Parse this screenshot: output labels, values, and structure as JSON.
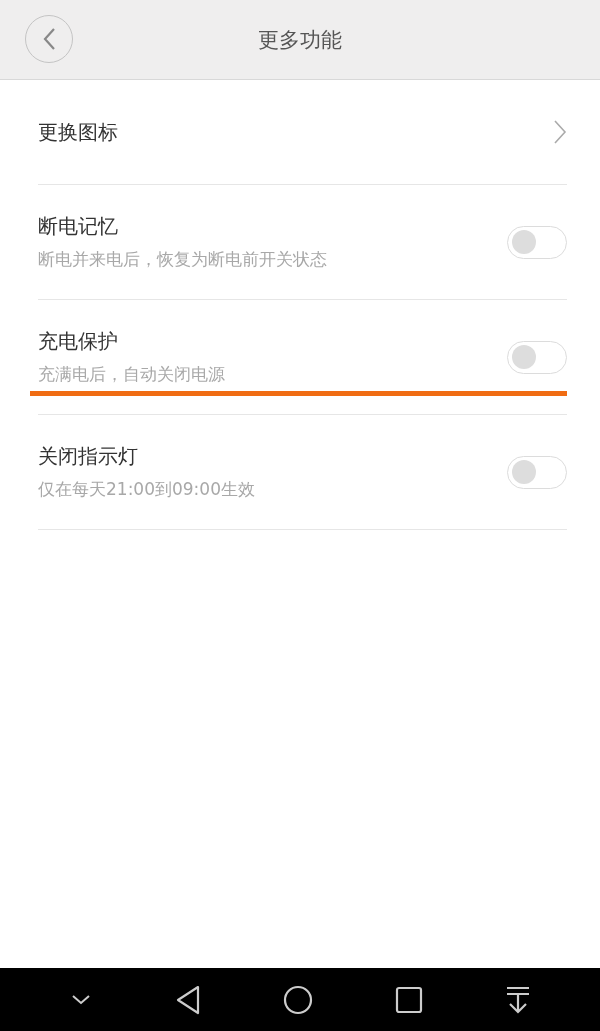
{
  "header": {
    "title": "更多功能"
  },
  "items": [
    {
      "kind": "link",
      "title": "更换图标"
    },
    {
      "kind": "toggle",
      "title": "断电记忆",
      "subtitle": "断电并来电后，恢复为断电前开关状态",
      "on": false,
      "highlighted": false
    },
    {
      "kind": "toggle",
      "title": "充电保护",
      "subtitle": "充满电后，自动关闭电源",
      "on": false,
      "highlighted": true
    },
    {
      "kind": "toggle",
      "title": "关闭指示灯",
      "subtitle": "仅在每天21:00到09:00生效",
      "on": false,
      "highlighted": false
    }
  ]
}
